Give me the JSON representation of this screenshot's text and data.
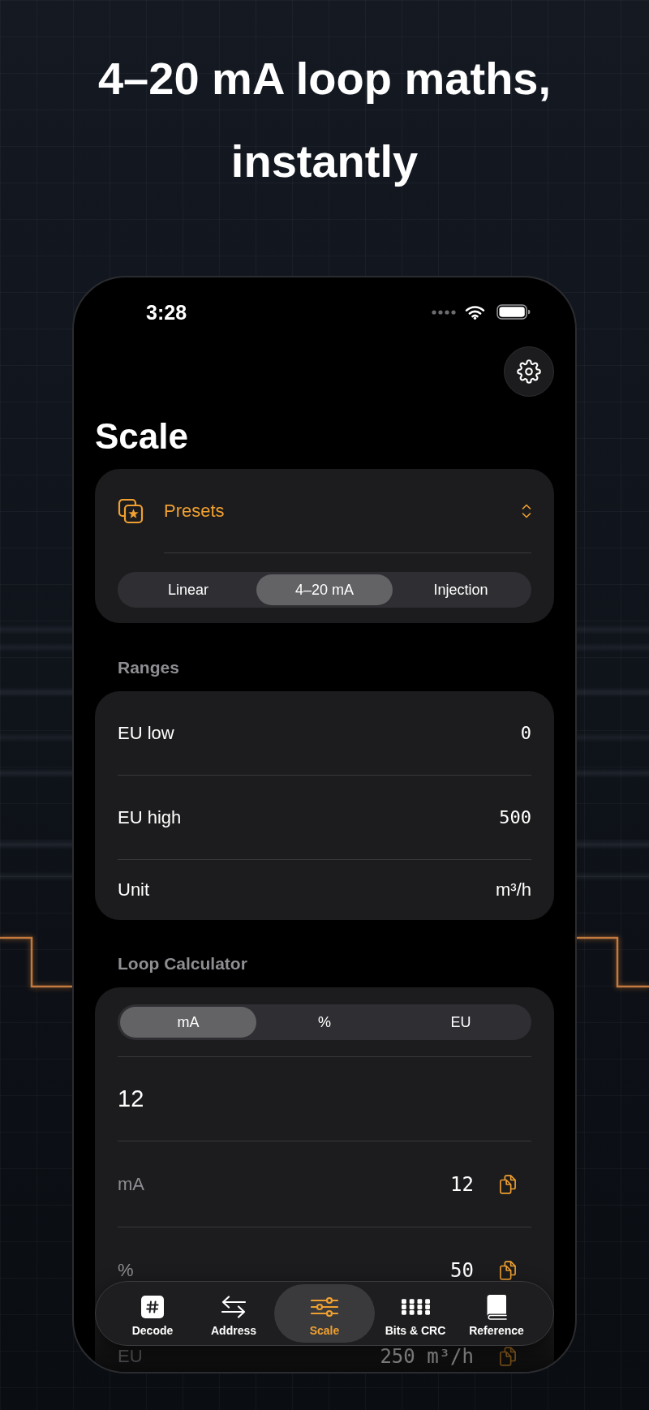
{
  "headline": "4–20 mA loop maths, instantly",
  "status_bar": {
    "time": "3:28"
  },
  "screen": {
    "title": "Scale"
  },
  "presets": {
    "label": "Presets",
    "modes": [
      {
        "label": "Linear",
        "selected": false
      },
      {
        "label": "4–20 mA",
        "selected": true
      },
      {
        "label": "Injection",
        "selected": false
      }
    ]
  },
  "ranges": {
    "title": "Ranges",
    "rows": [
      {
        "kind": "field",
        "label": "EU low",
        "value": "0"
      },
      {
        "kind": "field",
        "label": "EU high",
        "value": "500"
      },
      {
        "kind": "picker",
        "label": "Unit",
        "value": "m³/h"
      }
    ]
  },
  "loop_calculator": {
    "title": "Loop Calculator",
    "units": [
      {
        "label": "mA",
        "selected": true
      },
      {
        "label": "%",
        "selected": false
      },
      {
        "label": "EU",
        "selected": false
      }
    ],
    "input": {
      "value": "12"
    },
    "results": [
      {
        "label": "mA",
        "value": "12"
      },
      {
        "label": "%",
        "value": "50"
      },
      {
        "label": "EU",
        "value": "250 m³/h"
      }
    ]
  },
  "tab_bar": [
    {
      "label": "Decode",
      "selected": false
    },
    {
      "label": "Address",
      "selected": false
    },
    {
      "label": "Scale",
      "selected": true
    },
    {
      "label": "Bits & CRC",
      "selected": false
    },
    {
      "label": "Reference",
      "selected": false
    }
  ]
}
